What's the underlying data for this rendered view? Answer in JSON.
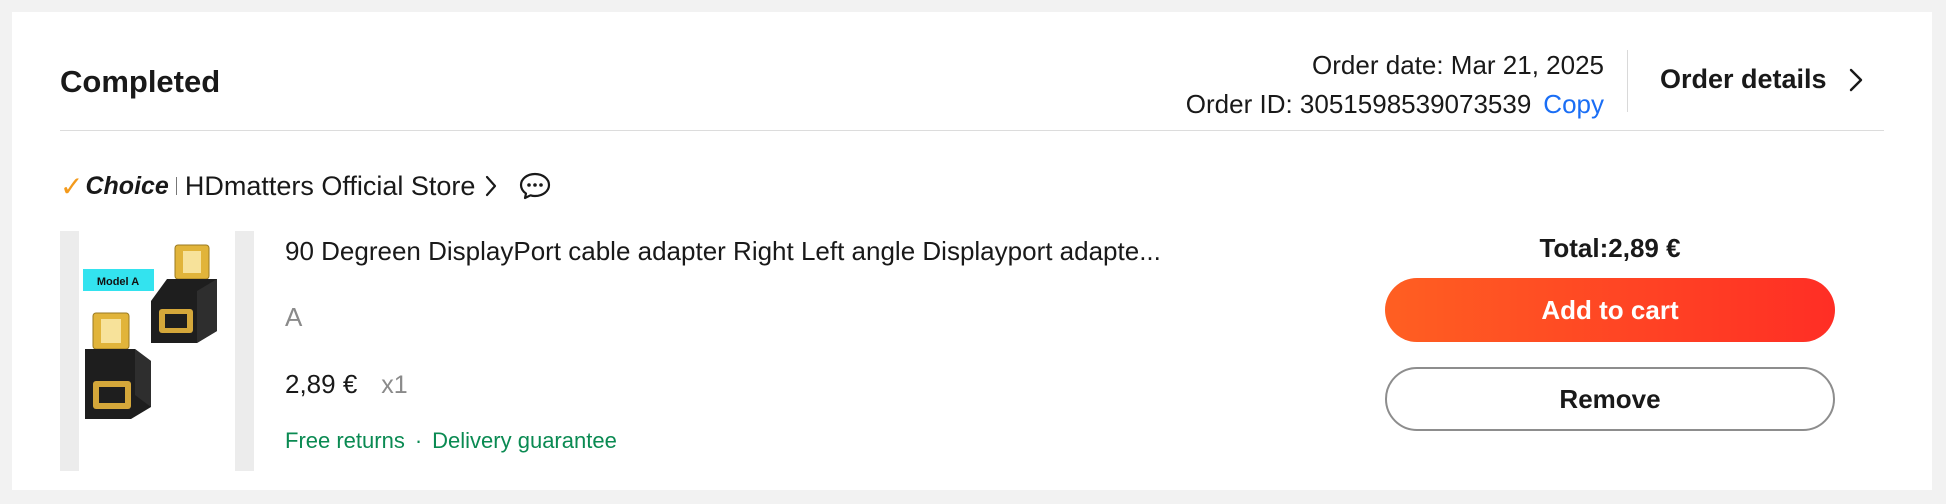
{
  "order": {
    "status": "Completed",
    "date_text": "Order date: Mar 21, 2025",
    "id_text": "Order ID: 3051598539073539",
    "copy_label": "Copy",
    "details_label": "Order details"
  },
  "store": {
    "badge_check": "✓",
    "badge_label": "Choice",
    "name": "HDmatters Official Store"
  },
  "product": {
    "image_text": "Model A",
    "title": "90 Degreen DisplayPort cable adapter Right Left angle Displayport adapte...",
    "variant": "A",
    "price": "2,89 €",
    "quantity": "x1",
    "tag_returns": "Free returns",
    "tag_separator": "·",
    "tag_delivery": "Delivery guarantee"
  },
  "summary": {
    "total_text": "Total:2,89 €",
    "add_to_cart_label": "Add to cart",
    "remove_label": "Remove"
  },
  "colors": {
    "accent_link": "#1a6ef5",
    "cart_button": "#ff3d24",
    "choice_check": "#f39a1c",
    "tag_green": "#0a8a52"
  }
}
